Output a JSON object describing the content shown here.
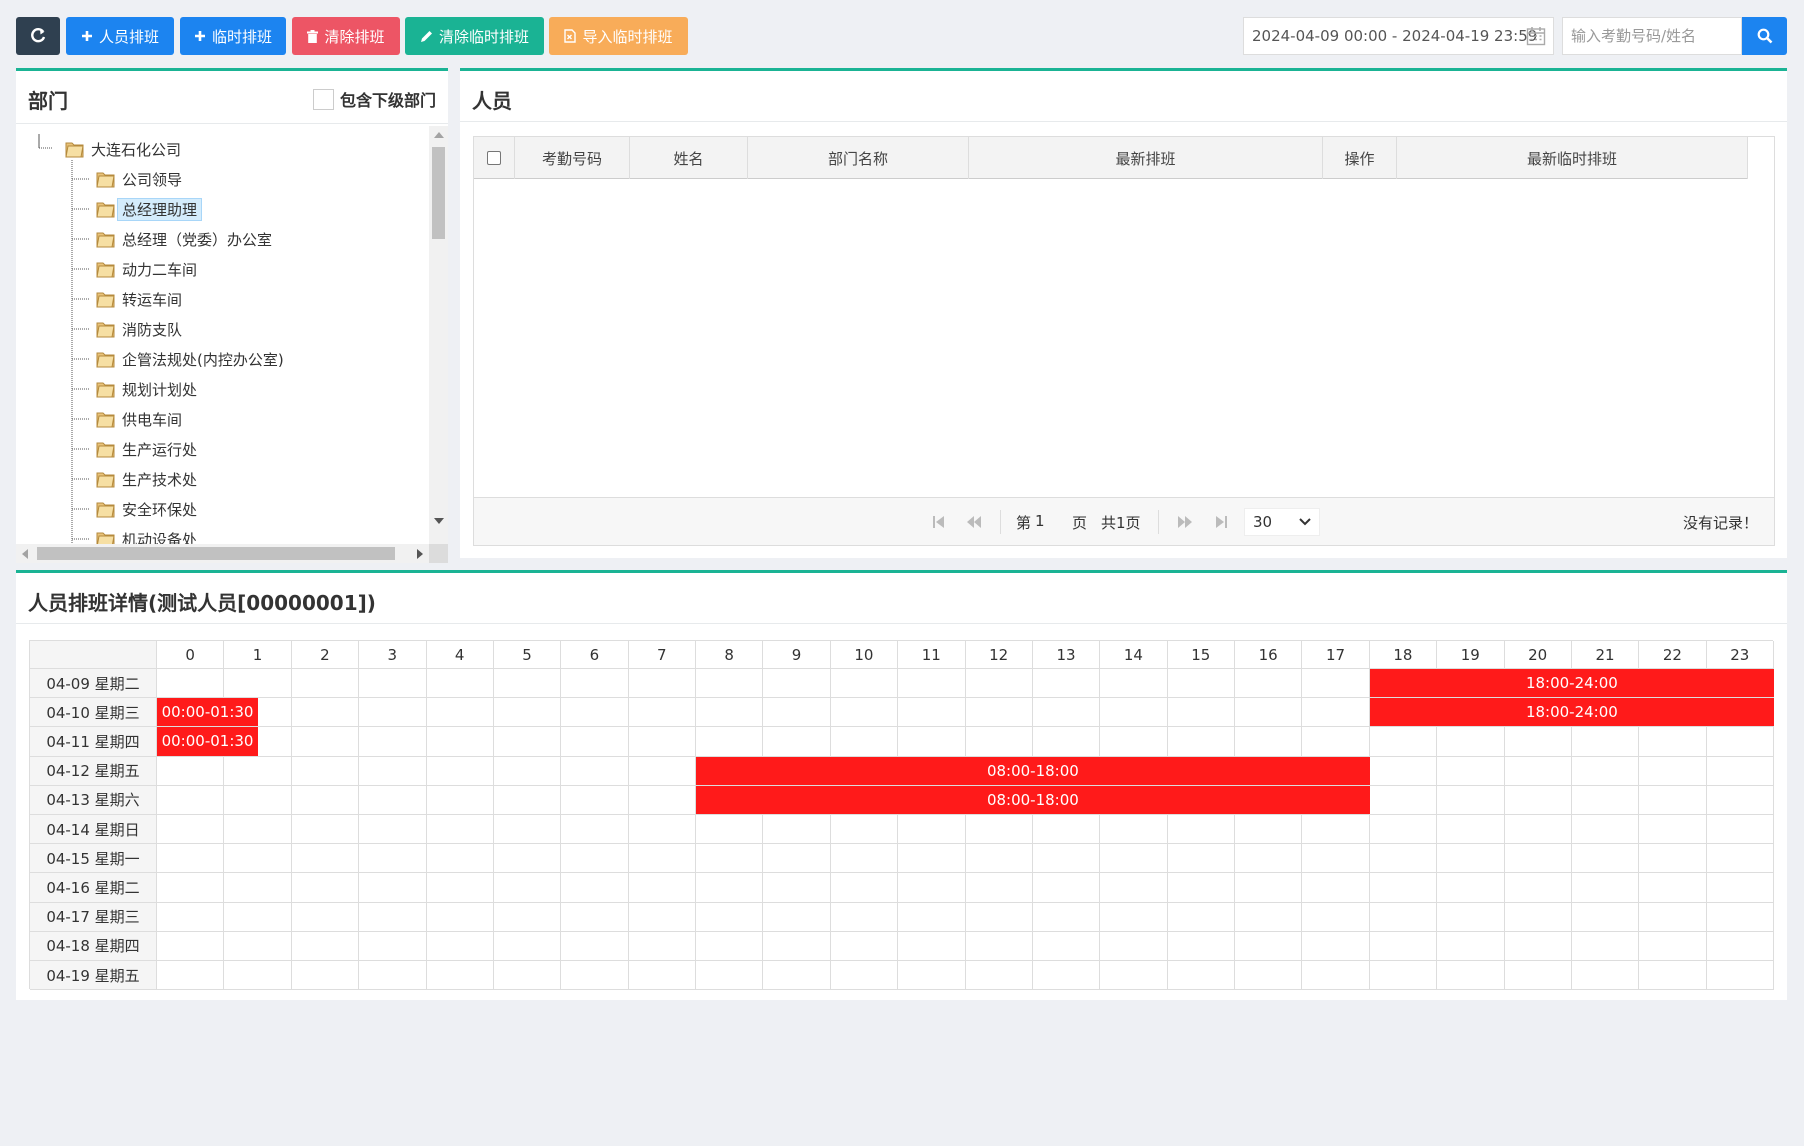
{
  "toolbar": {
    "refresh_icon": "refresh-icon",
    "buttons": {
      "person_schedule": "人员排班",
      "temp_schedule": "临时排班",
      "clear_schedule": "清除排班",
      "clear_temp_schedule": "清除临时排班",
      "import_temp_schedule": "导入临时排班"
    },
    "date_range": "2024-04-09 00:00 - 2024-04-19 23:59",
    "search_placeholder": "输入考勤号码/姓名"
  },
  "department_panel": {
    "title": "部门",
    "include_sub_label": "包含下级部门",
    "tree": {
      "root": "大连石化公司",
      "children": [
        "公司领导",
        "总经理助理",
        "总经理（党委）办公室",
        "动力二车间",
        "转运车间",
        "消防支队",
        "企管法规处(内控办公室)",
        "规划计划处",
        "供电车间",
        "生产运行处",
        "生产技术处",
        "安全环保处",
        "机动设备处"
      ],
      "selected": "总经理助理"
    }
  },
  "person_panel": {
    "title": "人员",
    "columns": [
      "考勤号码",
      "姓名",
      "部门名称",
      "最新排班",
      "操作",
      "最新临时排班"
    ],
    "pager": {
      "page_prefix": "第",
      "page_value": "1",
      "page_suffix": "页",
      "total": "共1页",
      "page_size": "30",
      "no_records": "没有记录！"
    }
  },
  "schedule_panel": {
    "title": "人员排班详情(测试人员[00000001])",
    "hours": [
      "0",
      "1",
      "2",
      "3",
      "4",
      "5",
      "6",
      "7",
      "8",
      "9",
      "10",
      "11",
      "12",
      "13",
      "14",
      "15",
      "16",
      "17",
      "18",
      "19",
      "20",
      "21",
      "22",
      "23"
    ],
    "days": [
      "04-09 星期二",
      "04-10 星期三",
      "04-11 星期四",
      "04-12 星期五",
      "04-13 星期六",
      "04-14 星期日",
      "04-15 星期一",
      "04-16 星期二",
      "04-17 星期三",
      "04-18 星期四",
      "04-19 星期五"
    ],
    "shifts": [
      {
        "day": 0,
        "start": 18,
        "end": 24,
        "label": "18:00-24:00"
      },
      {
        "day": 1,
        "start": 0,
        "end": 1.5,
        "label": "00:00-01:30"
      },
      {
        "day": 1,
        "start": 18,
        "end": 24,
        "label": "18:00-24:00"
      },
      {
        "day": 2,
        "start": 0,
        "end": 1.5,
        "label": "00:00-01:30"
      },
      {
        "day": 3,
        "start": 8,
        "end": 18,
        "label": "08:00-18:00"
      },
      {
        "day": 4,
        "start": 8,
        "end": 18,
        "label": "08:00-18:00"
      }
    ],
    "shift_color": "#ff1a1a"
  }
}
